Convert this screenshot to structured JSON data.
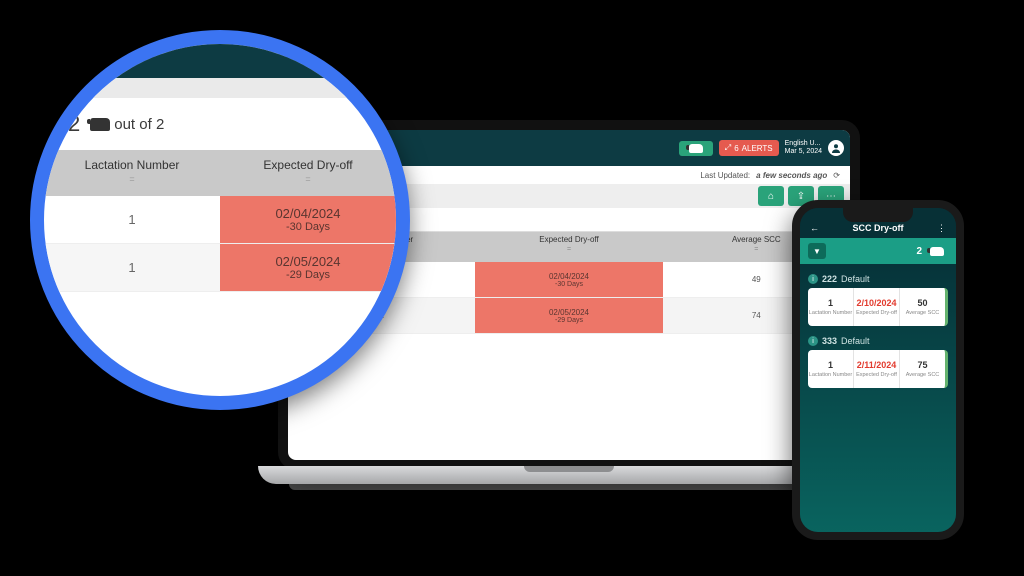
{
  "desktop": {
    "topbar": {
      "alerts_count": "6",
      "alerts_label": "ALERTS",
      "language": "English U...",
      "date": "Mar 5, 2024"
    },
    "last_updated_prefix": "Last Updated:",
    "last_updated_value": "a few seconds ago",
    "count_big": "2",
    "count_rest": "out of  2",
    "columns": [
      "Lactation Number",
      "Expected Dry-off",
      "Average SCC"
    ],
    "eq": "=",
    "rows": [
      {
        "lact": "1",
        "date": "02/04/2024",
        "days": "-30 Days",
        "scc": "49"
      },
      {
        "lact": "1",
        "date": "02/05/2024",
        "days": "-29 Days",
        "scc": "74"
      }
    ]
  },
  "mag": {
    "count_big": "2",
    "count_rest": "out of  2",
    "columns": [
      "Lactation Number",
      "Expected Dry-off"
    ],
    "eq": "=",
    "rows": [
      {
        "lact": "1",
        "date": "02/04/2024",
        "days": "-30 Days"
      },
      {
        "lact": "1",
        "date": "02/05/2024",
        "days": "-29 Days"
      }
    ]
  },
  "phone": {
    "back": "←",
    "title": "SCC Dry-off",
    "menu": "⋮",
    "filter": "▼",
    "summary_count": "2",
    "labels": {
      "lact": "Lactation Number",
      "dry": "Expected Dry-off",
      "scc": "Average SCC"
    },
    "cards": [
      {
        "id": "222",
        "group": "Default",
        "lact": "1",
        "date": "2/10/2024",
        "scc": "50"
      },
      {
        "id": "333",
        "group": "Default",
        "lact": "1",
        "date": "2/11/2024",
        "scc": "75"
      }
    ]
  }
}
